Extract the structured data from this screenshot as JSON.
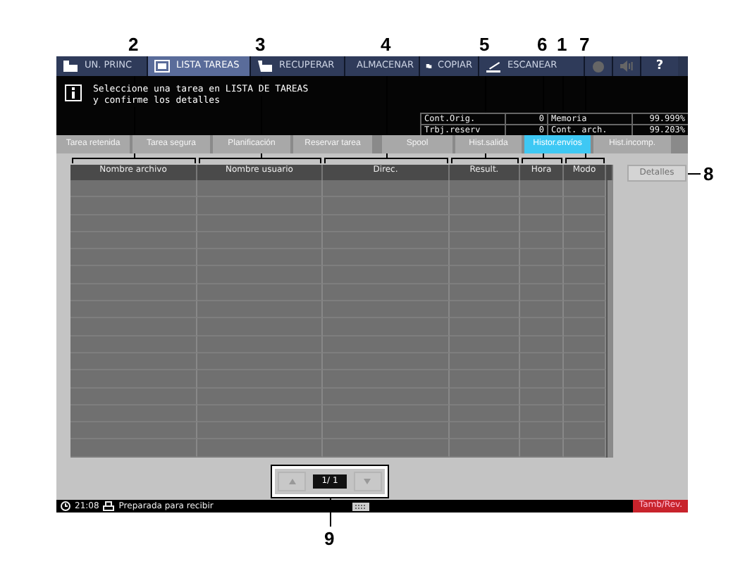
{
  "nav_tabs": [
    {
      "label": "UN. PRINC",
      "selected": false
    },
    {
      "label": "LISTA TAREAS",
      "selected": true
    },
    {
      "label": "RECUPERAR",
      "selected": false
    },
    {
      "label": "ALMACENAR",
      "selected": false
    },
    {
      "label": "COPIAR",
      "selected": false
    },
    {
      "label": "ESCANEAR",
      "selected": false
    }
  ],
  "help_button": "?",
  "message": {
    "line_1": "Seleccione una tarea en LISTA DE TAREAS",
    "line_2": "y confirme los detalles"
  },
  "counters": [
    {
      "label": "Cont.Orig.",
      "value": "0",
      "label_2": "Memoria",
      "value_2": "99.999%"
    },
    {
      "label": "Trbj.reserv",
      "value": "0",
      "label_2": "Cont. arch.",
      "value_2": "99.203%"
    }
  ],
  "sub_tabs": [
    {
      "label": "Tarea retenida",
      "selected": false
    },
    {
      "label": "Tarea segura",
      "selected": false
    },
    {
      "label": "Planificación",
      "selected": false
    },
    {
      "label": "Reservar tarea",
      "selected": false
    },
    {
      "label": "Spool",
      "selected": false
    },
    {
      "label": "Hist.salida",
      "selected": false
    },
    {
      "label": "Histor.envíos",
      "selected": true,
      "callout": "1"
    },
    {
      "label": "Hist.incomp.",
      "selected": false
    }
  ],
  "table": {
    "columns": [
      {
        "label": "Nombre archivo",
        "callout": "2"
      },
      {
        "label": "Nombre usuario",
        "callout": "3"
      },
      {
        "label": "Direc.",
        "callout": "4"
      },
      {
        "label": "Result.",
        "callout": "5"
      },
      {
        "label": "Hora",
        "callout": "6"
      },
      {
        "label": "Modo",
        "callout": "7"
      }
    ]
  },
  "details_button": {
    "label": "Detalles",
    "disabled": true,
    "callout": "8"
  },
  "pager": {
    "page": "1/ 1",
    "callout": "9"
  },
  "status_bar": {
    "time": "21:08",
    "status": "Preparada para recibir",
    "right_button": "Tamb/Rev."
  }
}
